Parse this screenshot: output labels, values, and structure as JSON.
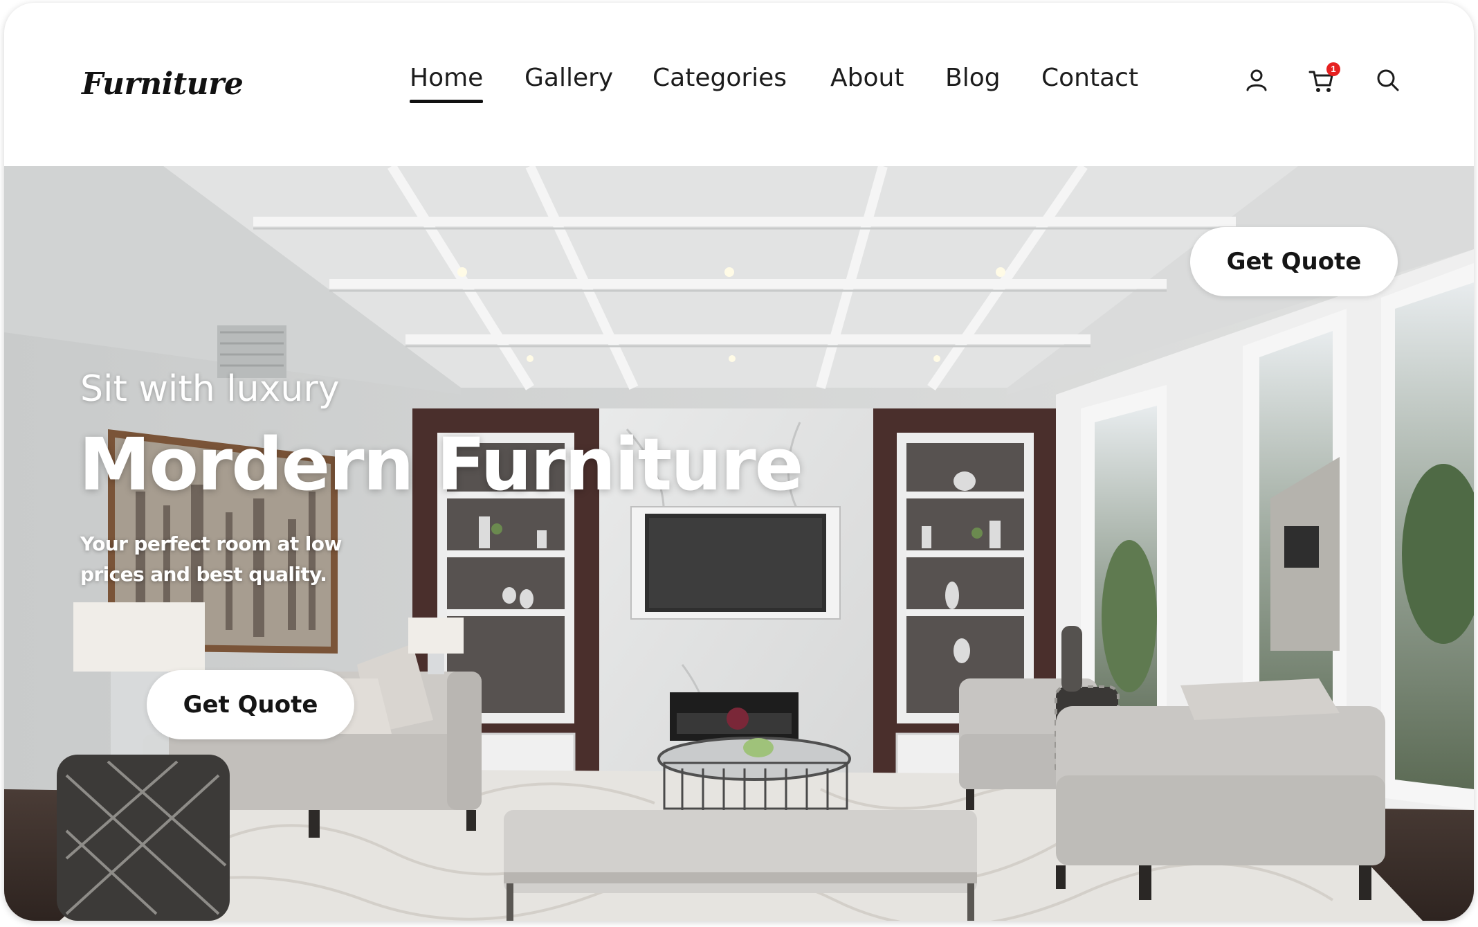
{
  "header": {
    "logo": "Furniture",
    "nav": [
      {
        "label": "Home",
        "active": true
      },
      {
        "label": "Gallery",
        "active": false
      },
      {
        "label": "Categories",
        "active": false
      },
      {
        "label": "About",
        "active": false
      },
      {
        "label": "Blog",
        "active": false
      },
      {
        "label": "Contact",
        "active": false
      }
    ],
    "icons": [
      "user-icon",
      "cart-icon",
      "search-icon"
    ],
    "cart_count": "1"
  },
  "hero": {
    "cta_top": "Get Quote",
    "subtitle": "Sit with luxury",
    "title": "Mordern Furniture",
    "description": "Your perfect room at low prices and best quality.",
    "cta": "Get Quote"
  },
  "colors": {
    "text": "#1c1c1c",
    "badge": "#e62020",
    "button_bg": "#ffffff",
    "cabinet": "#4a2f2c"
  }
}
